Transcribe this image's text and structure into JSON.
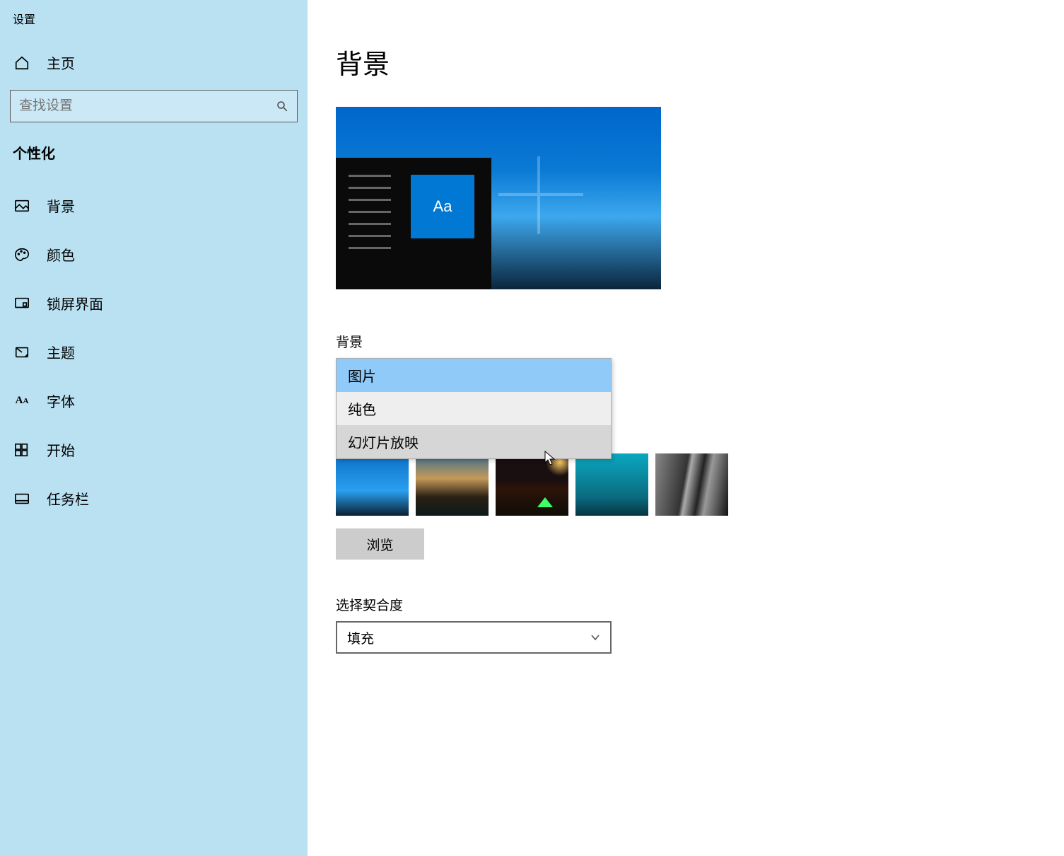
{
  "app": {
    "title": "设置"
  },
  "sidebar": {
    "home_label": "主页",
    "search_placeholder": "查找设置",
    "section_title": "个性化",
    "items": [
      {
        "label": "背景"
      },
      {
        "label": "颜色"
      },
      {
        "label": "锁屏界面"
      },
      {
        "label": "主题"
      },
      {
        "label": "字体"
      },
      {
        "label": "开始"
      },
      {
        "label": "任务栏"
      }
    ]
  },
  "main": {
    "page_title": "背景",
    "preview_tile_text": "Aa",
    "background_label": "背景",
    "background_options": [
      {
        "label": "图片",
        "selected": true
      },
      {
        "label": "纯色",
        "selected": false
      },
      {
        "label": "幻灯片放映",
        "selected": false,
        "hover": true
      }
    ],
    "browse_label": "浏览",
    "fit_label": "选择契合度",
    "fit_value": "填充"
  }
}
